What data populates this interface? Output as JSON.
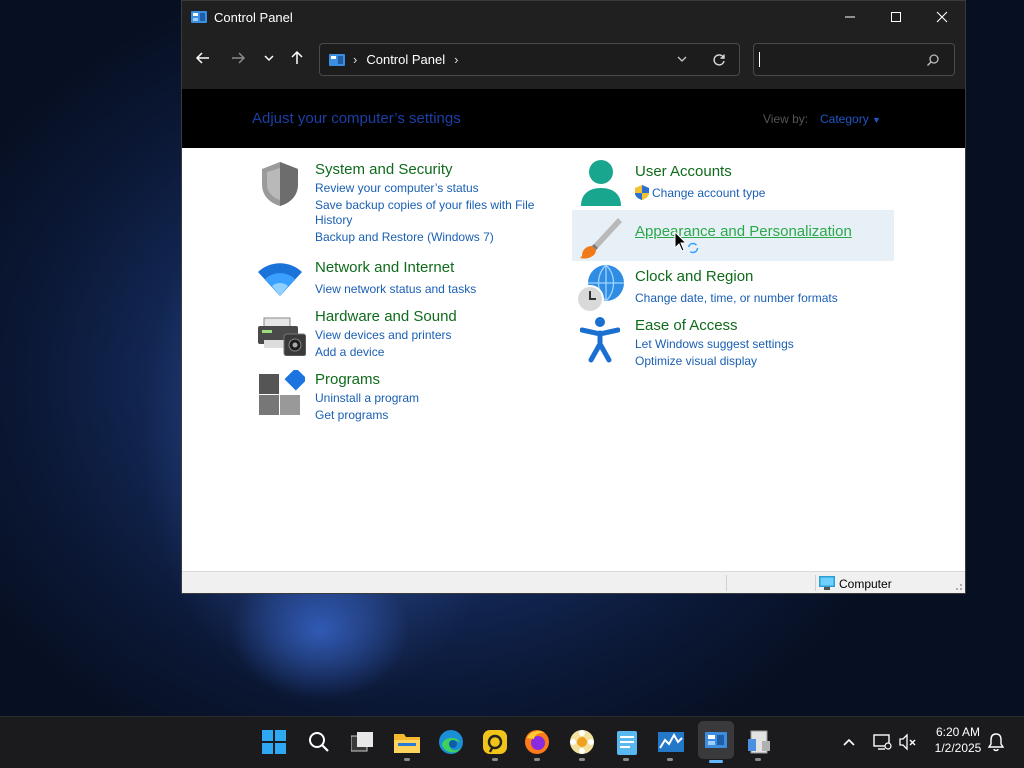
{
  "window": {
    "title": "Control Panel",
    "address": {
      "crumb": "Control Panel"
    },
    "search": {
      "placeholder": ""
    }
  },
  "header": {
    "heading": "Adjust your computer’s settings",
    "view_by_label": "View by:",
    "view_by_value": "Category"
  },
  "categories_left": [
    {
      "title": "System and Security",
      "links": [
        "Review your computer’s status",
        "Save backup copies of your files with File",
        "History",
        "Backup and Restore (Windows 7)"
      ]
    },
    {
      "title": "Network and Internet",
      "links": [
        "View network status and tasks"
      ]
    },
    {
      "title": "Hardware and Sound",
      "links": [
        "View devices and printers",
        "Add a device"
      ]
    },
    {
      "title": "Programs",
      "links": [
        "Uninstall a program",
        "Get programs"
      ]
    }
  ],
  "categories_right": [
    {
      "title": "User Accounts",
      "links": [
        "Change account type"
      ]
    },
    {
      "title": "Appearance and Personalization",
      "links": []
    },
    {
      "title": "Clock and Region",
      "links": [
        "Change date, time, or number formats"
      ]
    },
    {
      "title": "Ease of Access",
      "links": [
        "Let Windows suggest settings",
        "Optimize visual display"
      ]
    }
  ],
  "statusbar": {
    "location": "Computer"
  },
  "taskbar": {
    "time": "6:20 AM",
    "date": "1/2/2025",
    "pinned": [
      "start-icon",
      "search-icon",
      "task-view-icon",
      "file-explorer-icon",
      "edge-icon",
      "app-yellow-icon",
      "firefox-icon",
      "app-flower-icon",
      "notepad-icon",
      "task-manager-icon",
      "control-panel-icon",
      "app-misc-icon"
    ]
  },
  "colors": {
    "link": "#1a5fb4",
    "category_title": "#0f6b1b",
    "hover_title": "#2ba84a",
    "header_bg": "#000000",
    "heading": "#1a3fa6"
  }
}
